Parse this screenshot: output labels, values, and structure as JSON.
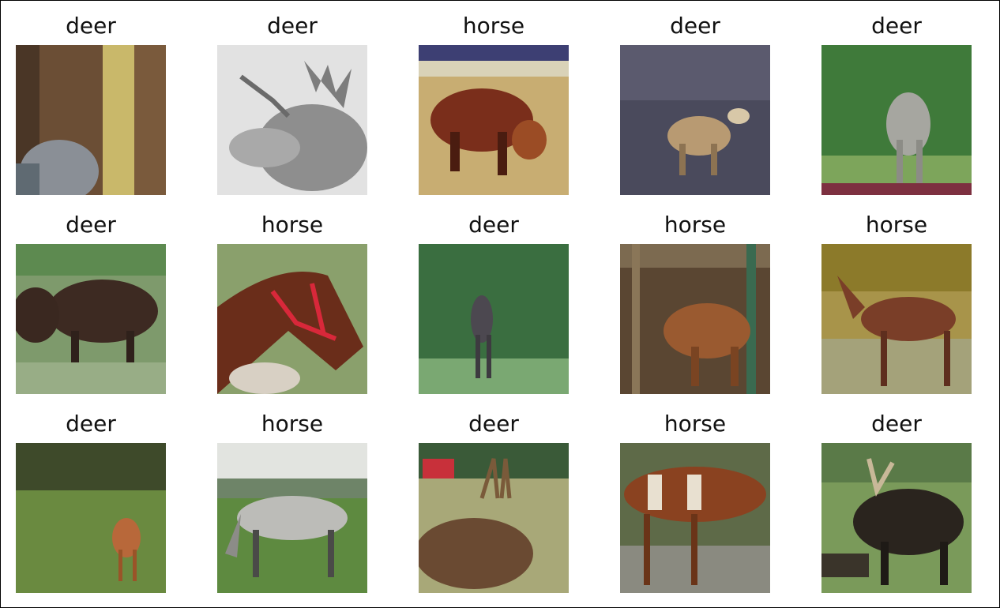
{
  "grid": {
    "rows": 3,
    "cols": 5,
    "items": [
      {
        "label": "deer"
      },
      {
        "label": "deer"
      },
      {
        "label": "horse"
      },
      {
        "label": "deer"
      },
      {
        "label": "deer"
      },
      {
        "label": "deer"
      },
      {
        "label": "horse"
      },
      {
        "label": "deer"
      },
      {
        "label": "horse"
      },
      {
        "label": "horse"
      },
      {
        "label": "deer"
      },
      {
        "label": "horse"
      },
      {
        "label": "deer"
      },
      {
        "label": "horse"
      },
      {
        "label": "deer"
      }
    ]
  }
}
